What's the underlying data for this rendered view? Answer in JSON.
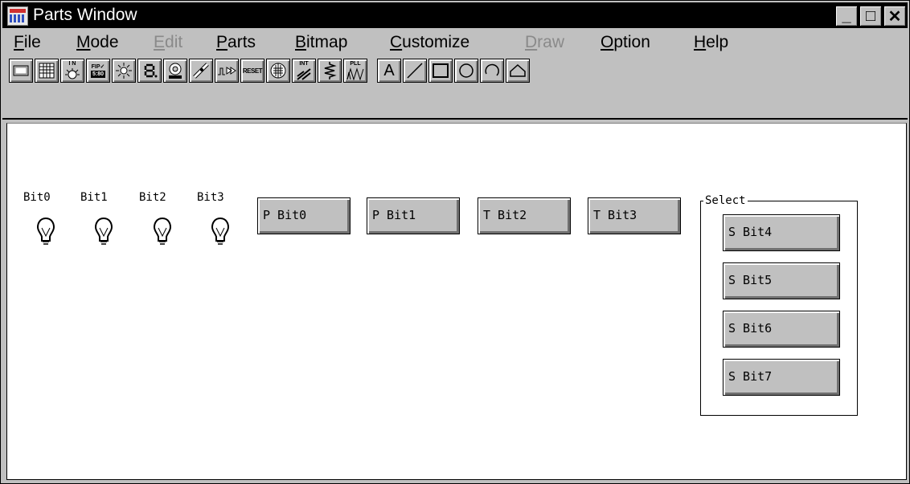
{
  "window": {
    "title": "Parts Window",
    "controls": {
      "minimize": "_",
      "maximize": "□",
      "close": "✕"
    }
  },
  "menu": [
    {
      "label": "File",
      "accel": "F",
      "rest": "ile",
      "enabled": true
    },
    {
      "label": "Mode",
      "accel": "M",
      "rest": "ode",
      "enabled": true
    },
    {
      "label": "Edit",
      "accel": "E",
      "rest": "dit",
      "enabled": false
    },
    {
      "label": "Parts",
      "accel": "P",
      "rest": "arts",
      "enabled": true
    },
    {
      "label": "Bitmap",
      "accel": "B",
      "rest": "itmap",
      "enabled": true
    },
    {
      "label": "Customize",
      "accel": "C",
      "rest": "ustomize",
      "enabled": true
    },
    {
      "label": "Draw",
      "accel": "D",
      "rest": "raw",
      "enabled": false
    },
    {
      "label": "Option",
      "accel": "O",
      "rest": "ption",
      "enabled": true
    },
    {
      "label": "Help",
      "accel": "H",
      "rest": "elp",
      "enabled": true
    }
  ],
  "toolbar": {
    "buttons": [
      {
        "icon": "panel-icon"
      },
      {
        "icon": "keypad-icon"
      },
      {
        "icon": "input-led-icon",
        "text": "I N"
      },
      {
        "icon": "fip-display-icon",
        "text": "FIP✓",
        "text2": "5:80"
      },
      {
        "icon": "led-icon"
      },
      {
        "icon": "segment-display-icon"
      },
      {
        "icon": "buzzer-icon"
      },
      {
        "icon": "level-gauge-icon"
      },
      {
        "icon": "signal-output-icon"
      },
      {
        "icon": "reset-icon",
        "text": "RESET"
      },
      {
        "icon": "matrix-led-icon"
      },
      {
        "icon": "interrupt-icon",
        "text": "INT"
      },
      {
        "icon": "pull-resistor-icon"
      },
      {
        "icon": "pll-icon",
        "text": "PLL"
      },
      {
        "icon": "text-tool-icon",
        "text": "A"
      },
      {
        "icon": "line-tool-icon"
      },
      {
        "icon": "rectangle-tool-icon"
      },
      {
        "icon": "ellipse-tool-icon"
      },
      {
        "icon": "arc-tool-icon"
      },
      {
        "icon": "polygon-tool-icon"
      }
    ]
  },
  "canvas": {
    "bits": [
      "Bit0",
      "Bit1",
      "Bit2",
      "Bit3"
    ],
    "push_buttons": [
      "P Bit0",
      "P Bit1"
    ],
    "toggle_buttons": [
      "T Bit2",
      "T Bit3"
    ],
    "select_group": {
      "label": "Select",
      "buttons": [
        "S Bit4",
        "S Bit5",
        "S Bit6",
        "S Bit7"
      ]
    }
  }
}
